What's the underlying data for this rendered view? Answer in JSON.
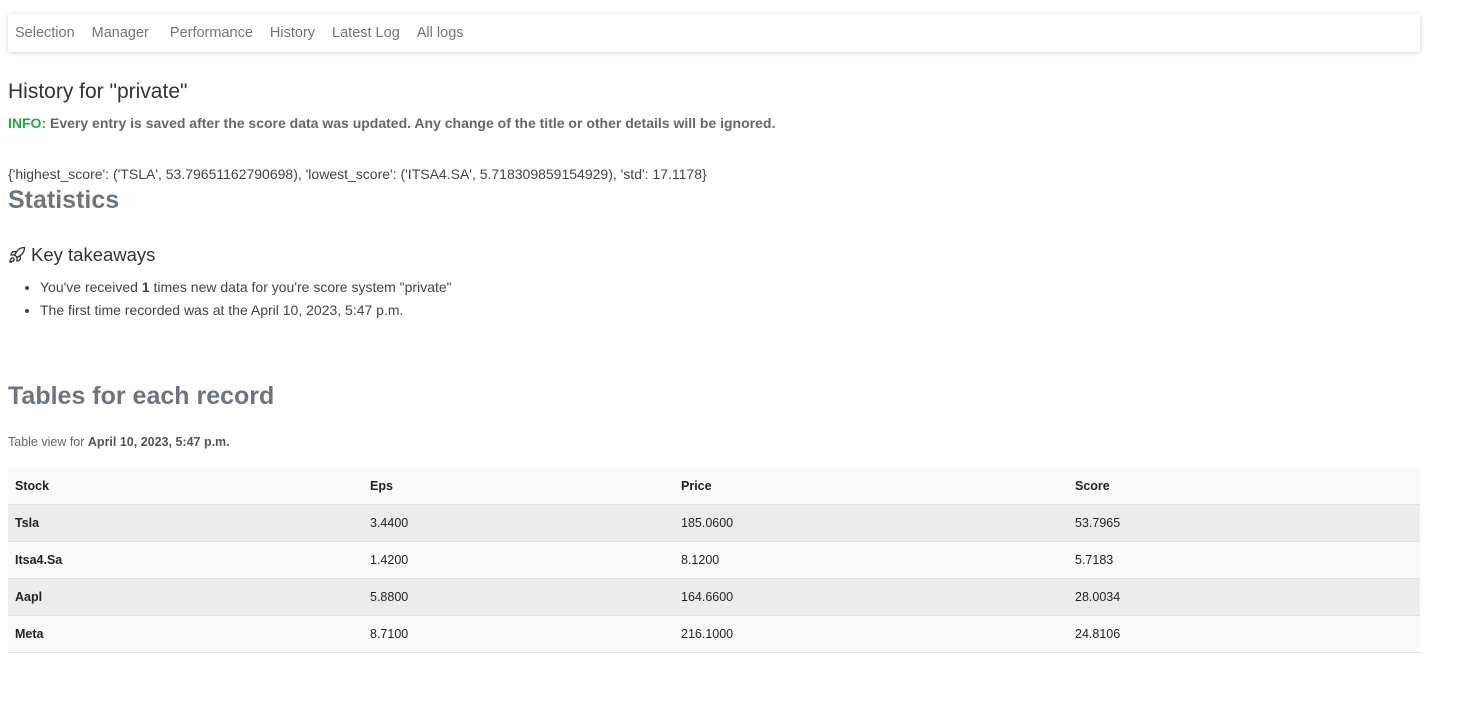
{
  "nav": {
    "items": [
      "Selection",
      "Manager",
      "Performance",
      "History",
      "Latest Log",
      "All logs"
    ]
  },
  "page": {
    "title": "History for \"private\"",
    "info_tag": "INFO:",
    "info_text": " Every entry is saved after the score data was updated. Any change of the title or other details will be ignored.",
    "stats_line": "{'highest_score': ('TSLA', 53.79651162790698), 'lowest_score': ('ITSA4.SA', 5.718309859154929), 'std': 17.1178}",
    "statistics_heading": "Statistics",
    "takeaways_heading": "Key takeaways",
    "takeaways": {
      "item1_pre": "You've received ",
      "item1_count": "1",
      "item1_post": " times new data for you're score system \"private\"",
      "item2": "The first time recorded was at the April 10, 2023, 5:47 p.m."
    },
    "tables_heading": "Tables for each record",
    "table_caption_pre": "Table view for ",
    "table_caption_date": "April 10, 2023, 5:47 p.m."
  },
  "table": {
    "headers": [
      "Stock",
      "Eps",
      "Price",
      "Score"
    ],
    "rows": [
      [
        "Tsla",
        "3.4400",
        "185.0600",
        "53.7965"
      ],
      [
        "Itsa4.Sa",
        "1.4200",
        "8.1200",
        "5.7183"
      ],
      [
        "Aapl",
        "5.8800",
        "164.6600",
        "28.0034"
      ],
      [
        "Meta",
        "8.7100",
        "216.1000",
        "24.8106"
      ]
    ]
  },
  "colors": {
    "info_green": "#28a745",
    "heading_gray": "#6c757d",
    "row_stripe": "#ececec"
  },
  "icons": {
    "takeaways": "rocket-icon"
  }
}
